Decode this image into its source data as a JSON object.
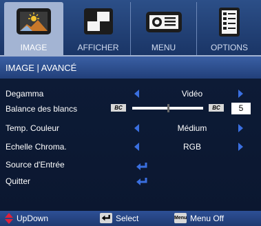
{
  "tabs": [
    {
      "label": "IMAGE",
      "icon": "image-icon",
      "active": true
    },
    {
      "label": "AFFICHER",
      "icon": "display-icon",
      "active": false
    },
    {
      "label": "MENU",
      "icon": "projector-icon",
      "active": false
    },
    {
      "label": "OPTIONS",
      "icon": "options-icon",
      "active": false
    }
  ],
  "title": "IMAGE | AVANCÉ",
  "rows": {
    "degamma": {
      "label": "Degamma",
      "value": "Vidéo"
    },
    "balance": {
      "label": "Balance des blancs",
      "badge_left": "BC",
      "badge_right": "BC",
      "value": "5",
      "level": 0.5
    },
    "temp": {
      "label": "Temp. Couleur",
      "value": "Médium"
    },
    "chroma": {
      "label": "Echelle Chroma.",
      "value": "RGB"
    },
    "source": {
      "label": "Source d'Entrée"
    },
    "quit": {
      "label": "Quitter"
    }
  },
  "footer": {
    "updown": "UpDown",
    "select": "Select",
    "menu_key": "Menu",
    "menu_off": "Menu Off"
  },
  "colors": {
    "accent_arrow": "#3a6fe0",
    "updown_arrow": "#e0203a",
    "active_tab": "#a3b4d3"
  }
}
